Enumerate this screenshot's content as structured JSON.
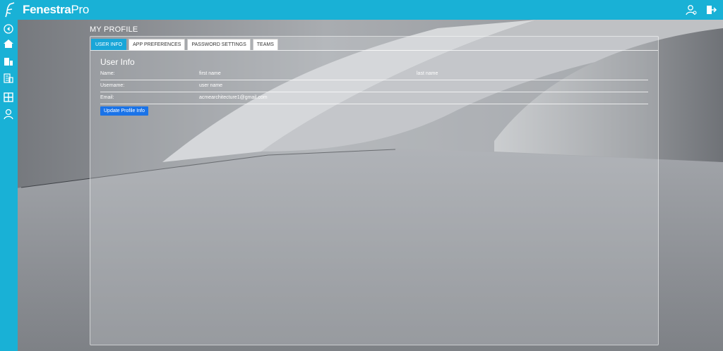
{
  "app": {
    "brand_bold": "Fenestra",
    "brand_light": "Pro"
  },
  "topbar": {
    "icons": [
      "user-settings-icon",
      "logout-icon"
    ]
  },
  "sidebar": {
    "items": [
      "collapse-icon",
      "home-icon",
      "buildings-icon",
      "projects-icon",
      "layout-icon",
      "user-icon"
    ]
  },
  "page": {
    "title": "MY PROFILE"
  },
  "tabs": [
    {
      "label": "USER INFO",
      "active": true
    },
    {
      "label": "APP PREFERENCES",
      "active": false
    },
    {
      "label": "PASSWORD SETTINGS",
      "active": false
    },
    {
      "label": "TEAMS",
      "active": false
    }
  ],
  "user_info": {
    "section_title": "User Info",
    "name_label": "Name:",
    "first_name": "first name",
    "last_name": "last name",
    "username_label": "Username:",
    "username": "user name",
    "email_label": "Email:",
    "email": "acmearchitecture1@gmail.com",
    "update_button": "Update Profile Info"
  },
  "colors": {
    "accent": "#19b1d6",
    "tab_active": "#19a6d8",
    "button": "#1a73e8"
  }
}
